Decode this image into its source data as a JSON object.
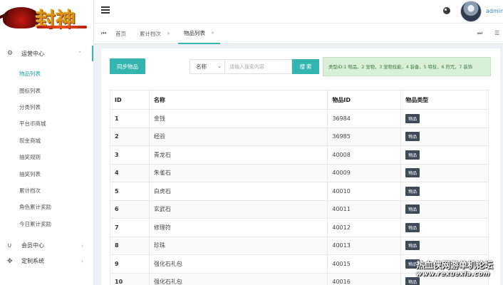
{
  "logo": {
    "text": "封神"
  },
  "sidebar": {
    "groups": [
      {
        "icon": "gear-icon",
        "label": "运营中心",
        "open": true,
        "items": [
          "物品列表",
          "图标列表",
          "分类列表",
          "平台币商城",
          "现金商城",
          "抽奖规则",
          "抽奖列表",
          "累计档次",
          "角色累计奖励",
          "今日累计奖励"
        ]
      },
      {
        "icon": "magnet-icon",
        "label": "会员中心"
      },
      {
        "icon": "gamepad-icon",
        "label": "定制系统"
      }
    ]
  },
  "topbar": {
    "username": "admin"
  },
  "tabs": [
    {
      "label": "首页"
    },
    {
      "label": "累计档次",
      "closable": true
    },
    {
      "label": "物品列表",
      "closable": true,
      "active": true
    }
  ],
  "toolbar": {
    "sync_label": "同步物品",
    "select_value": "名称",
    "search_placeholder": "请输入搜索内容",
    "search_label": "搜 索",
    "notice": "类型ID:1 物品，2 宠物，3 宠物技能，4 装备，5 特技，6 符咒，7 装饰"
  },
  "table": {
    "headers": [
      "ID",
      "名称",
      "物品ID",
      "物品类型"
    ],
    "rows": [
      [
        "1",
        "金钱",
        "36984",
        "物品"
      ],
      [
        "2",
        "经验",
        "36985",
        "物品"
      ],
      [
        "3",
        "青龙石",
        "40008",
        "物品"
      ],
      [
        "4",
        "朱雀石",
        "40009",
        "物品"
      ],
      [
        "5",
        "白虎石",
        "40010",
        "物品"
      ],
      [
        "6",
        "玄武石",
        "40011",
        "物品"
      ],
      [
        "7",
        "修理符",
        "40012",
        "物品"
      ],
      [
        "8",
        "珍珠",
        "40013",
        "物品"
      ],
      [
        "9",
        "强化石礼包",
        "40015",
        "物品"
      ],
      [
        "10",
        "强化石礼包",
        "40016",
        "物品"
      ]
    ]
  },
  "watermark": {
    "line1": "热血侠网游单机论坛",
    "line2": "www.rexuexia.com"
  },
  "colors": {
    "accent": "#34b5af",
    "active_text": "#21a79f",
    "badge": "#3f4a59",
    "notice_bg": "#d9efd8"
  }
}
